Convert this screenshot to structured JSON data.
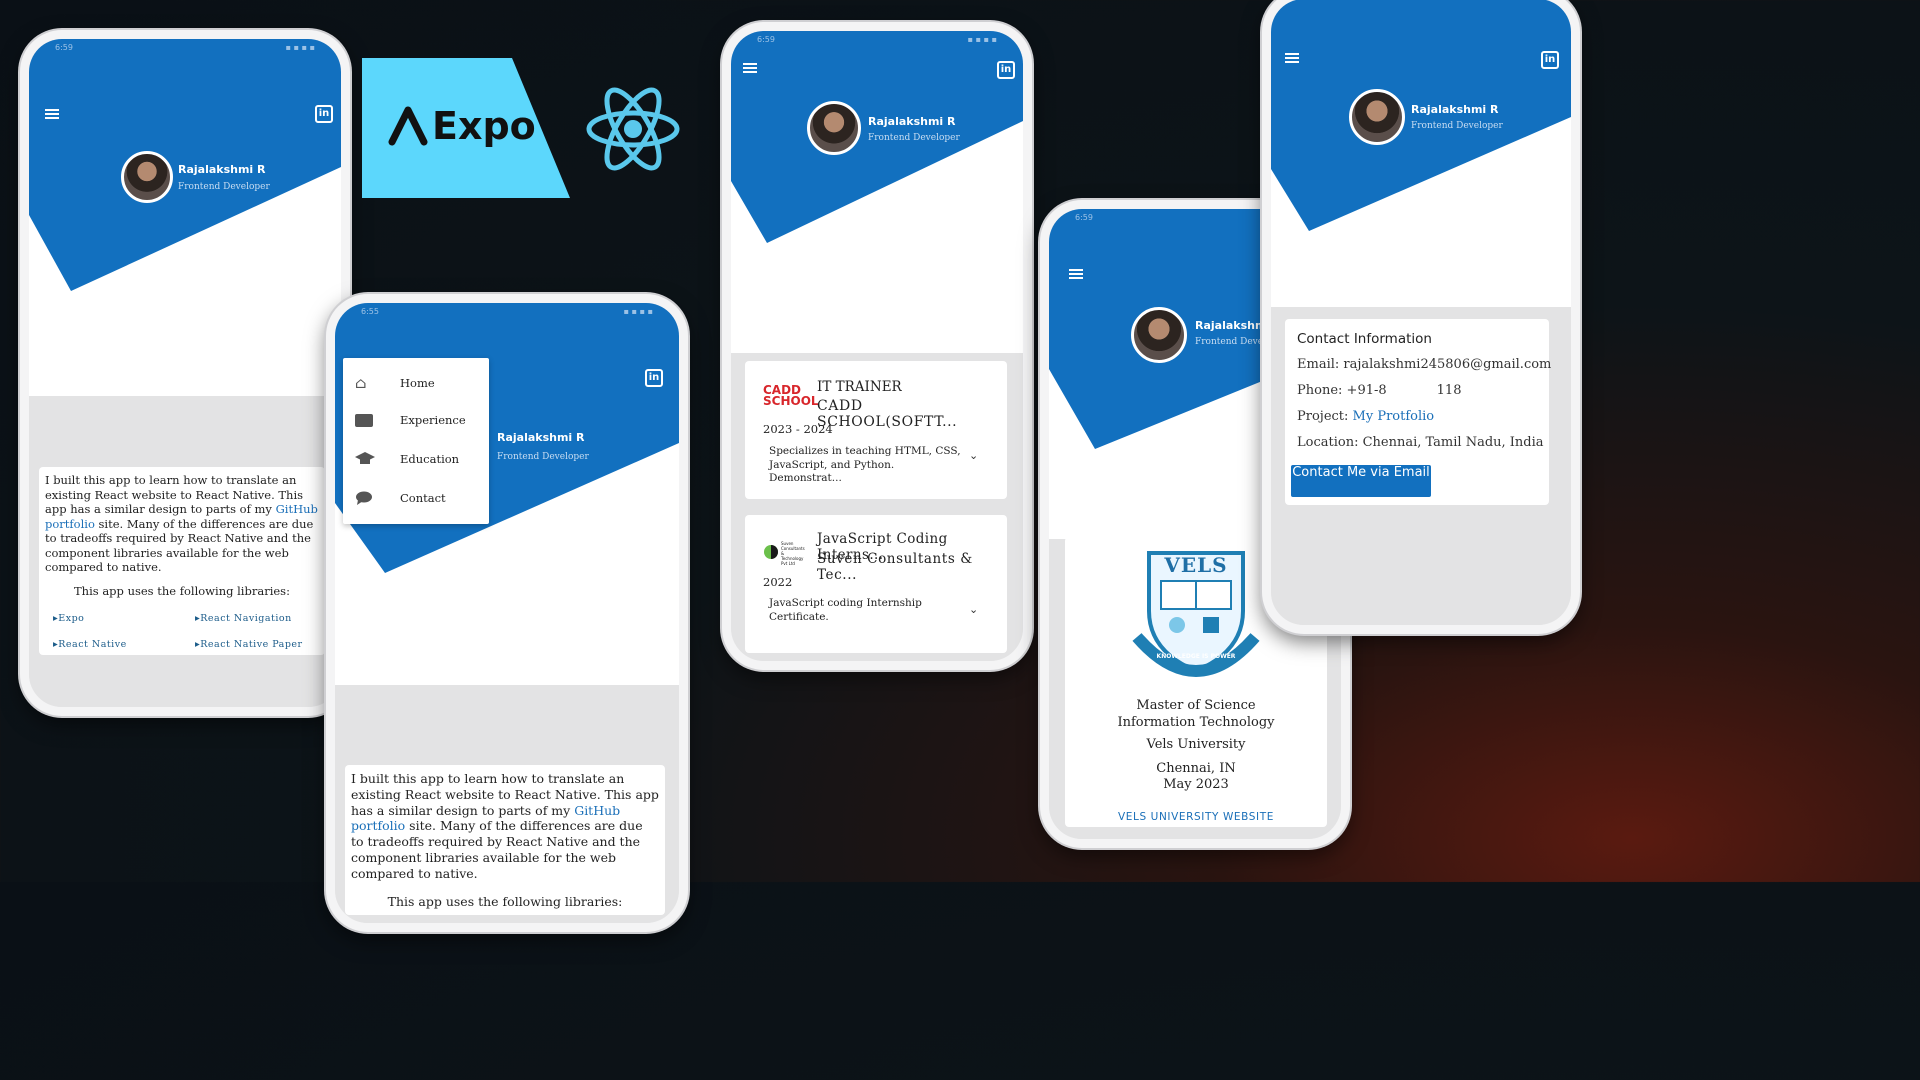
{
  "profile": {
    "name": "Rajalakshmi R",
    "role": "Frontend Developer"
  },
  "about": {
    "intro_before_link": "I built this app to learn how to translate an existing React website to React Native. This app has a similar design to parts of my ",
    "link_text": "GitHub portfolio",
    "intro_after_link": " site. Many of the differences are due to tradeoffs required by React Native and the component libraries available for the web compared to native.",
    "libraries_heading": "This app uses the following libraries:",
    "libraries_heading_partial": "This app uses the following libraries:",
    "libraries": [
      "Expo",
      "React Navigation",
      "React Native",
      "React Native Paper"
    ]
  },
  "logos": {
    "expo": "Expo",
    "react": "react-icon"
  },
  "drawer": {
    "items": [
      {
        "label": "Home",
        "icon": "home-icon"
      },
      {
        "label": "Experience",
        "icon": "briefcase-icon"
      },
      {
        "label": "Education",
        "icon": "graduation-cap-icon"
      },
      {
        "label": "Contact",
        "icon": "chat-icon"
      }
    ]
  },
  "experience": [
    {
      "title": "IT TRAINER",
      "company": "CADD SCHOOL(SOFTT...",
      "logo_text": "CADD SCHOOL",
      "dates": "2023 - 2024",
      "description": "Specializes in teaching HTML, CSS, JavaScript, and Python. Demonstrat..."
    },
    {
      "title": "JavaScript Coding Interns...",
      "company": "Suven Consultants & Tec...",
      "logo_text": "Suven Consultants & Technology Pvt Ltd",
      "dates": "2022",
      "description": "JavaScript coding Internship Certificate."
    }
  ],
  "education": {
    "logo_text": "VELS",
    "logo_motto": "KNOWLEDGE IS POWER",
    "degree_line1": "Master of Science",
    "degree_line2": "Information Technology",
    "university": "Vels University",
    "location": "Chennai, IN",
    "date": "May 2023",
    "website_link": "VELS UNIVERSITY WEBSITE"
  },
  "contact": {
    "heading": "Contact Information",
    "email_label": "Email:",
    "email": "rajalakshmi245806@gmail.com",
    "phone_label": "Phone:",
    "phone_prefix": "+91-8",
    "phone_suffix": "118",
    "project_label": "Project:",
    "project_link": "My Protfolio",
    "location_label": "Location:",
    "location": "Chennai, Tamil Nadu, India",
    "button": "Contact Me via Email"
  },
  "colors": {
    "brand_blue": "#1270bf",
    "expo_bg": "#5cd7fc",
    "react": "#5ac8ec"
  }
}
